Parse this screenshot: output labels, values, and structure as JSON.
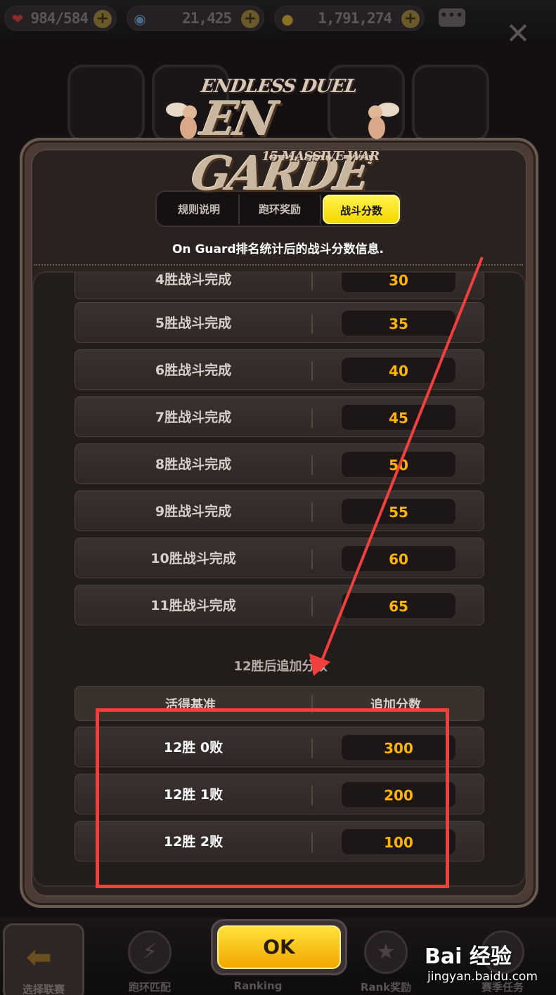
{
  "resources": [
    {
      "icon": "heart-icon",
      "value": "984/584"
    },
    {
      "icon": "gem-icon",
      "value": "21,425"
    },
    {
      "icon": "gold-icon",
      "value": "1,791,274"
    }
  ],
  "logo": {
    "line1": "ENDLESS DUEL",
    "line2": "EN GARDE",
    "line3": "15 MASSIVE WAR"
  },
  "tabs": [
    {
      "label": "规则说明",
      "active": false
    },
    {
      "label": "跑环奖励",
      "active": false
    },
    {
      "label": "战斗分数",
      "active": true
    }
  ],
  "info_text": "On Guard排名统计后的战斗分数信息.",
  "score_rows": [
    {
      "label": "4胜战斗完成",
      "value": "30"
    },
    {
      "label": "5胜战斗完成",
      "value": "35"
    },
    {
      "label": "6胜战斗完成",
      "value": "40"
    },
    {
      "label": "7胜战斗完成",
      "value": "45"
    },
    {
      "label": "8胜战斗完成",
      "value": "50"
    },
    {
      "label": "9胜战斗完成",
      "value": "55"
    },
    {
      "label": "10胜战斗完成",
      "value": "60"
    },
    {
      "label": "11胜战斗完成",
      "value": "65"
    }
  ],
  "bonus": {
    "title": "12胜后追加分数",
    "col_left": "活得基准",
    "col_right": "追加分数",
    "rows": [
      {
        "label": "12胜 0败",
        "value": "300"
      },
      {
        "label": "12胜 1败",
        "value": "200"
      },
      {
        "label": "12胜 2败",
        "value": "100"
      }
    ]
  },
  "ok_label": "OK",
  "bottom_nav": {
    "back": "选择联赛",
    "items": [
      "跑环匹配",
      "Ranking",
      "Rank奖励",
      "赛季任务"
    ]
  },
  "watermark": {
    "brand": "Bai 经验",
    "url": "jingyan.baidu.com"
  },
  "colors": {
    "accent_yellow": "#f4d800",
    "score_orange": "#ffb400",
    "annotation_red": "#f0403e"
  }
}
